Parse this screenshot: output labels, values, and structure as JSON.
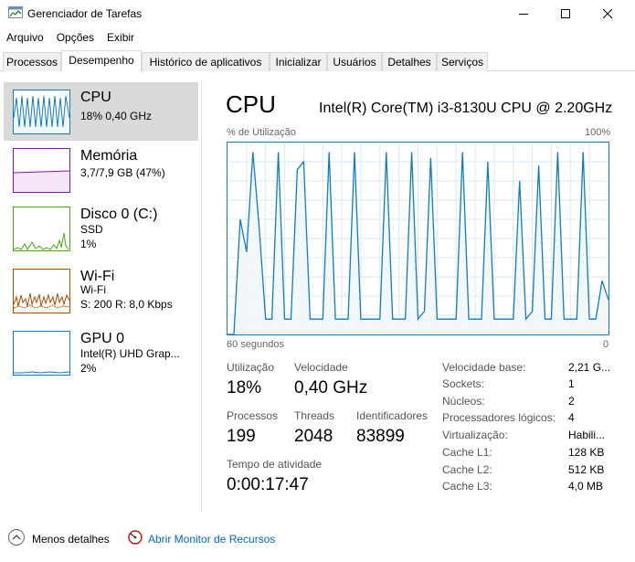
{
  "window": {
    "title": "Gerenciador de Tarefas",
    "minimize_glyph": "—",
    "maximize_glyph": "☐",
    "close_glyph": "✕"
  },
  "menu": [
    "Arquivo",
    "Opções",
    "Exibir"
  ],
  "tabs": [
    {
      "label": "Processos",
      "active": false
    },
    {
      "label": "Desempenho",
      "active": true
    },
    {
      "label": "Histórico de aplicativos",
      "active": false
    },
    {
      "label": "Inicializar",
      "active": false
    },
    {
      "label": "Usuários",
      "active": false
    },
    {
      "label": "Detalhes",
      "active": false
    },
    {
      "label": "Serviços",
      "active": false
    }
  ],
  "sidebar": {
    "items": [
      {
        "title": "CPU",
        "line1": "18% 0,40 GHz",
        "line2": "",
        "color": "#117dbb",
        "icon": "cpu-graph-icon"
      },
      {
        "title": "Memória",
        "line1": "3,7/7,9 GB (47%)",
        "line2": "",
        "color": "#8b12ae",
        "icon": "memory-graph-icon"
      },
      {
        "title": "Disco 0 (C:)",
        "line1": "SSD",
        "line2": "1%",
        "color": "#4da60c",
        "icon": "disk-graph-icon"
      },
      {
        "title": "Wi-Fi",
        "line1": "Wi-Fi",
        "line2": "S: 200 R: 8,0 Kbps",
        "color": "#a74f01",
        "icon": "wifi-graph-icon"
      },
      {
        "title": "GPU 0",
        "line1": "Intel(R) UHD Grap...",
        "line2": "2%",
        "color": "#117dbb",
        "icon": "gpu-graph-icon"
      }
    ]
  },
  "cpu": {
    "title": "CPU",
    "model": "Intel(R) Core(TM) i3-8130U CPU @ 2.20GHz",
    "chart_label_left": "% de Utilização",
    "chart_label_right": "100%",
    "axis_left": "60 segundos",
    "axis_right": "0"
  },
  "stats": {
    "utilization_label": "Utilização",
    "utilization_value": "18%",
    "speed_label": "Velocidade",
    "speed_value": "0,40 GHz",
    "processes_label": "Processos",
    "processes_value": "199",
    "threads_label": "Threads",
    "threads_value": "2048",
    "handles_label": "Identificadores",
    "handles_value": "83899",
    "uptime_label": "Tempo de atividade",
    "uptime_value": "0:00:17:47"
  },
  "info": [
    {
      "label": "Velocidade base:",
      "value": "2,21 G..."
    },
    {
      "label": "Sockets:",
      "value": "1"
    },
    {
      "label": "Núcleos:",
      "value": "2"
    },
    {
      "label": "Processadores lógicos:",
      "value": "4"
    },
    {
      "label": "Virtualização:",
      "value": "Habili..."
    },
    {
      "label": "Cache L1:",
      "value": "128 KB"
    },
    {
      "label": "Cache L2:",
      "value": "512 KB"
    },
    {
      "label": "Cache L3:",
      "value": "4,0 MB"
    }
  ],
  "bottom": {
    "less_details": "Menos detalhes",
    "resource_monitor": "Abrir Monitor de Recursos"
  },
  "chart_data": {
    "type": "area",
    "x": [
      60,
      59,
      58,
      57,
      56,
      55,
      54,
      53,
      52,
      51,
      50,
      49,
      48,
      47,
      46,
      45,
      44,
      43,
      42,
      41,
      40,
      39,
      38,
      37,
      36,
      35,
      34,
      33,
      32,
      31,
      30,
      29,
      28,
      27,
      26,
      25,
      24,
      23,
      22,
      21,
      20,
      19,
      18,
      17,
      16,
      15,
      14,
      13,
      12,
      11,
      10,
      9,
      8,
      7,
      6,
      5,
      4,
      3,
      2,
      1,
      0
    ],
    "series": [
      {
        "values": [
          0,
          0,
          60,
          43,
          95,
          55,
          8,
          8,
          95,
          8,
          8,
          86,
          90,
          8,
          8,
          8,
          95,
          8,
          8,
          8,
          95,
          8,
          8,
          8,
          8,
          95,
          8,
          8,
          8,
          95,
          8,
          12,
          92,
          8,
          8,
          8,
          8,
          95,
          8,
          8,
          8,
          90,
          8,
          8,
          8,
          8,
          80,
          8,
          12,
          88,
          8,
          8,
          95,
          8,
          8,
          8,
          95,
          8,
          8,
          28,
          18
        ]
      }
    ],
    "ylim": [
      0,
      100
    ],
    "xlim": [
      60,
      0
    ],
    "grid": true,
    "color": "#117dbb",
    "fill": "#f1f6fa"
  }
}
